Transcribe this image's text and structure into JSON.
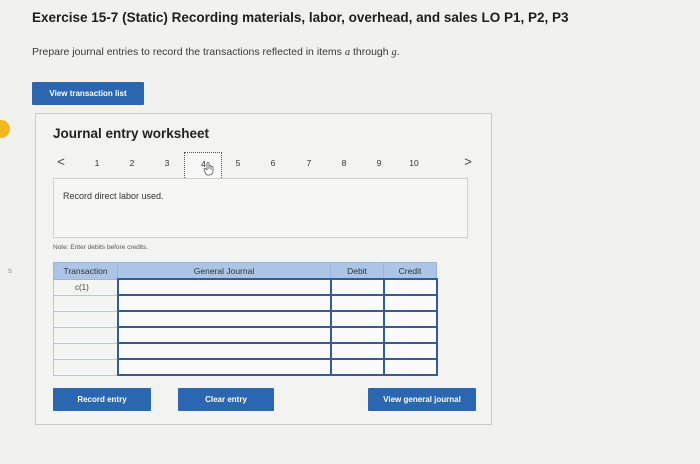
{
  "header": {
    "title": "Exercise 15-7 (Static) Recording materials, labor, overhead, and sales LO P1, P2, P3",
    "instructions_prefix": "Prepare journal entries to record the transactions reflected in items ",
    "item_a": "a",
    "instructions_mid": " through ",
    "item_g": "g",
    "instructions_end": "."
  },
  "buttons": {
    "view_transaction_list": "View transaction list",
    "record_entry": "Record entry",
    "clear_entry": "Clear entry",
    "view_general_journal": "View general journal"
  },
  "worksheet": {
    "title": "Journal entry worksheet",
    "pages": [
      "1",
      "2",
      "3",
      "4",
      "5",
      "6",
      "7",
      "8",
      "9",
      "10"
    ],
    "active_page": "4",
    "prev_arrow": "<",
    "next_arrow": ">",
    "description": "Record direct labor used.",
    "note": "Note: Enter debits before credits."
  },
  "journal_table": {
    "headers": {
      "transaction": "Transaction",
      "general_journal": "General Journal",
      "debit": "Debit",
      "credit": "Credit"
    },
    "rows": [
      {
        "transaction": "c(1)"
      },
      {
        "transaction": ""
      },
      {
        "transaction": ""
      },
      {
        "transaction": ""
      },
      {
        "transaction": ""
      },
      {
        "transaction": ""
      }
    ]
  },
  "colors": {
    "button_blue": "#2a67b0",
    "header_blue": "#acc4e6",
    "input_border": "#2f5d9e",
    "marker": "#f0b91f"
  },
  "icons": {
    "cursor": "hand-cursor-icon"
  }
}
